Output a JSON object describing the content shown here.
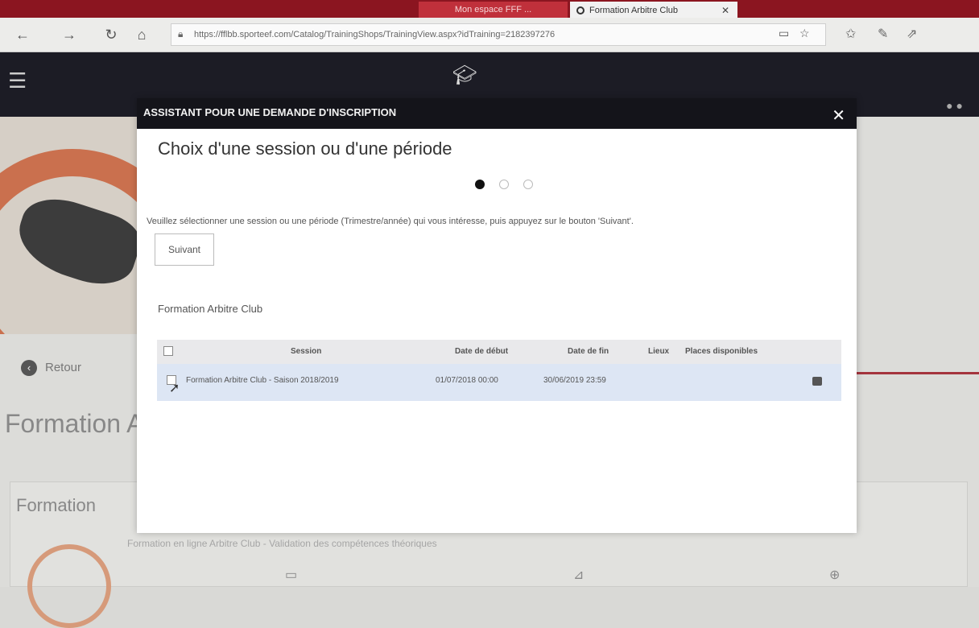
{
  "browser": {
    "inactive_tab": "Mon espace FFF ...",
    "active_tab": "Formation Arbitre Club",
    "active_tab_close": "✕",
    "url": "https://fflbb.sporteef.com/Catalog/TrainingShops/TrainingView.aspx?idTraining=2182397276",
    "nav": {
      "back": "←",
      "forward": "→",
      "refresh": "↻",
      "home": "⌂"
    },
    "icons": {
      "lock": "lock-icon",
      "reader": "reader-view-icon",
      "favorite": "star-icon",
      "hub": "hub-icon",
      "notes": "pen-icon",
      "share": "share-icon"
    }
  },
  "site": {
    "menu_icon": "☰",
    "logo_icon": "graduation-cap-icon",
    "back_label": "Retour",
    "page_title": "Formation A",
    "card_title": "Formation",
    "card_subtitle": "Formation en ligne Arbitre Club - Validation des compétences théoriques"
  },
  "modal": {
    "header": "ASSISTANT POUR UNE DEMANDE D'INSCRIPTION",
    "close": "✕",
    "step_title": "Choix d'une session ou d'une période",
    "steps": {
      "total": 3,
      "current": 1
    },
    "instruction": "Veuillez sélectionner une session ou une période (Trimestre/année) qui vous intéresse, puis appuyez sur le bouton 'Suivant'.",
    "next_button": "Suivant",
    "section_title": "Formation Arbitre Club",
    "table": {
      "headers": {
        "session": "Session",
        "start": "Date de début",
        "end": "Date de fin",
        "place": "Lieux",
        "seats": "Places disponibles"
      },
      "rows": [
        {
          "session": "Formation Arbitre Club - Saison 2018/2019",
          "start": "01/07/2018 00:00",
          "end": "30/06/2019 23:59",
          "place": "",
          "seats": ""
        }
      ]
    }
  }
}
